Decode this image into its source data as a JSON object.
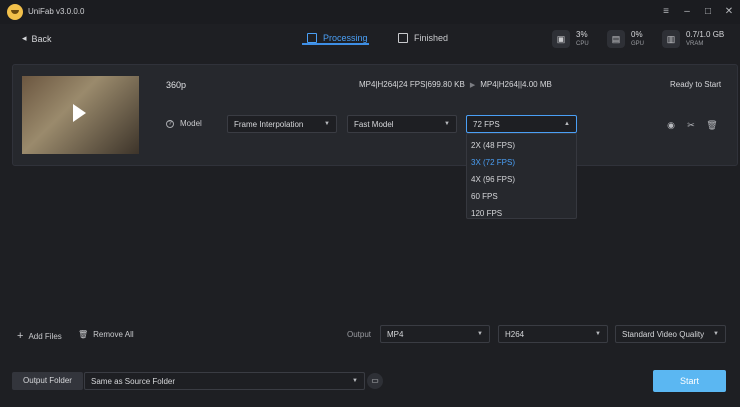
{
  "app": {
    "title": "UniFab v3.0.0.0"
  },
  "window_controls": {
    "menu": "≡",
    "minimize": "–",
    "maximize": "□",
    "close": "✕"
  },
  "nav": {
    "back_label": "Back"
  },
  "tabs": [
    {
      "label": "Processing",
      "active": true
    },
    {
      "label": "Finished",
      "active": false
    }
  ],
  "stats": {
    "cpu": {
      "value": "3%",
      "label": "CPU"
    },
    "gpu": {
      "value": "0%",
      "label": "GPU"
    },
    "vram": {
      "value": "0.7/1.0 GB",
      "label": "VRAM"
    }
  },
  "task": {
    "resolution": "360p",
    "source_info": "MP4|H264|24 FPS|699.80 KB",
    "target_info": "MP4|H264||4.00 MB",
    "status": "Ready to Start",
    "model_label": "Model",
    "mode_select": "Frame Interpolation",
    "model_select": "Fast Model",
    "fps_select": "72 FPS"
  },
  "fps_options": [
    {
      "label": "2X (48 FPS)",
      "selected": false
    },
    {
      "label": "3X (72 FPS)",
      "selected": true
    },
    {
      "label": "4X (96 FPS)",
      "selected": false
    },
    {
      "label": "60 FPS",
      "selected": false
    },
    {
      "label": "120 FPS",
      "selected": false
    }
  ],
  "bottom": {
    "add_files": "Add Files",
    "remove_all": "Remove All",
    "output_label": "Output",
    "format": "MP4",
    "codec": "H264",
    "quality": "Standard Video Quality",
    "output_folder_button": "Output Folder",
    "output_folder_value": "Same as Source Folder",
    "start_label": "Start"
  },
  "colors": {
    "accent": "#4a9ff5",
    "start_button": "#5bb7f2",
    "background": "#1e1f23"
  }
}
